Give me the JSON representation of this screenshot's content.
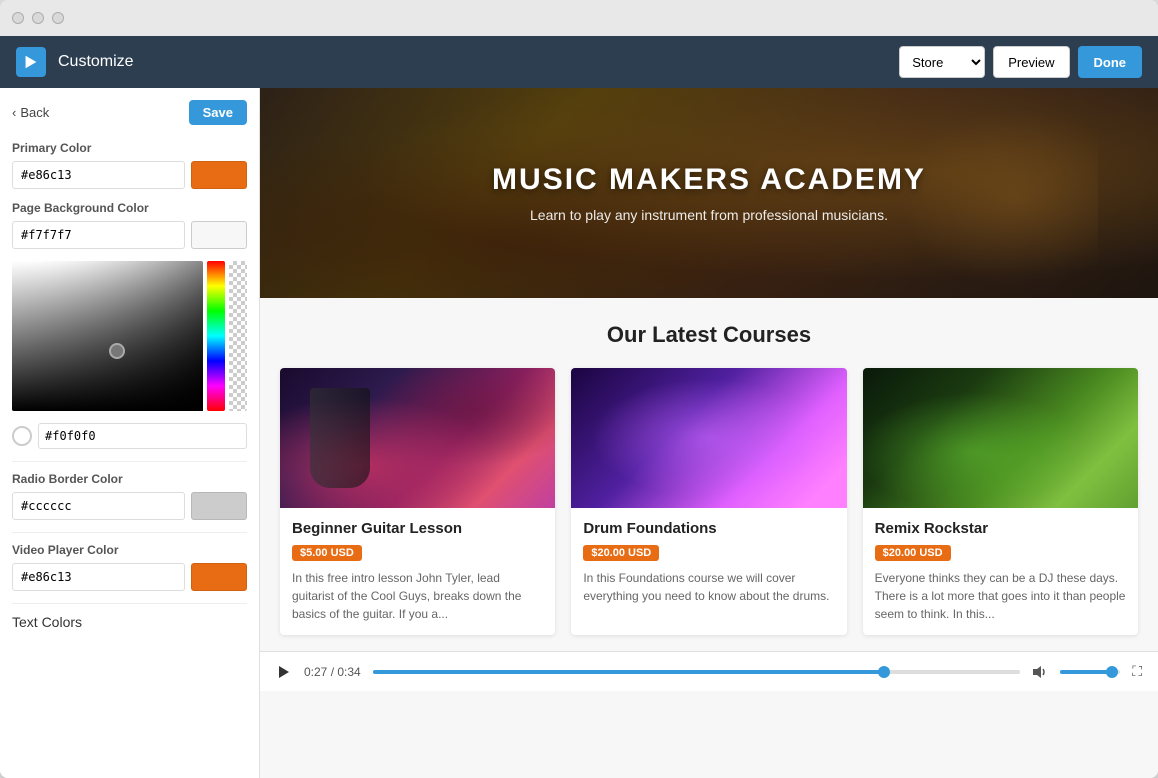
{
  "window": {
    "title": "Customize"
  },
  "header": {
    "title": "Customize",
    "store_select_value": "Store",
    "store_options": [
      "Store"
    ],
    "btn_preview": "Preview",
    "btn_done": "Done"
  },
  "sidebar": {
    "back_label": "Back",
    "save_label": "Save",
    "primary_color_label": "Primary Color",
    "primary_color_hex": "#e86c13",
    "primary_color_swatch": "#e86c13",
    "page_bg_label": "Page Background Color",
    "page_bg_hex": "#f7f7f7",
    "picker_hex": "#f0f0f0",
    "radio_border_label": "Radio Border Color",
    "radio_border_hex": "#cccccc",
    "radio_border_swatch": "#cccccc",
    "video_player_label": "Video Player Color",
    "video_player_hex": "#e86c13",
    "video_player_swatch": "#e86c13",
    "text_colors_label": "Text Colors"
  },
  "preview": {
    "hero_title": "MUSIC MAKERS ACADEMY",
    "hero_subtitle": "Learn to play any instrument from professional musicians.",
    "courses_heading": "Our Latest Courses",
    "courses": [
      {
        "title": "Beginner Guitar Lesson",
        "price": "$5.00 USD",
        "description": "In this free intro lesson John Tyler, lead guitarist of the Cool Guys, breaks down the basics of the guitar. If you a..."
      },
      {
        "title": "Drum Foundations",
        "price": "$20.00 USD",
        "description": "In this Foundations course we will cover everything you need to know about the drums."
      },
      {
        "title": "Remix Rockstar",
        "price": "$20.00 USD",
        "description": "Everyone thinks they can be a DJ these days. There is a lot more that goes into it than people seem to think. In this..."
      }
    ]
  },
  "video_player": {
    "time_current": "0:27",
    "time_total": "0:34",
    "progress_percent": 79
  }
}
